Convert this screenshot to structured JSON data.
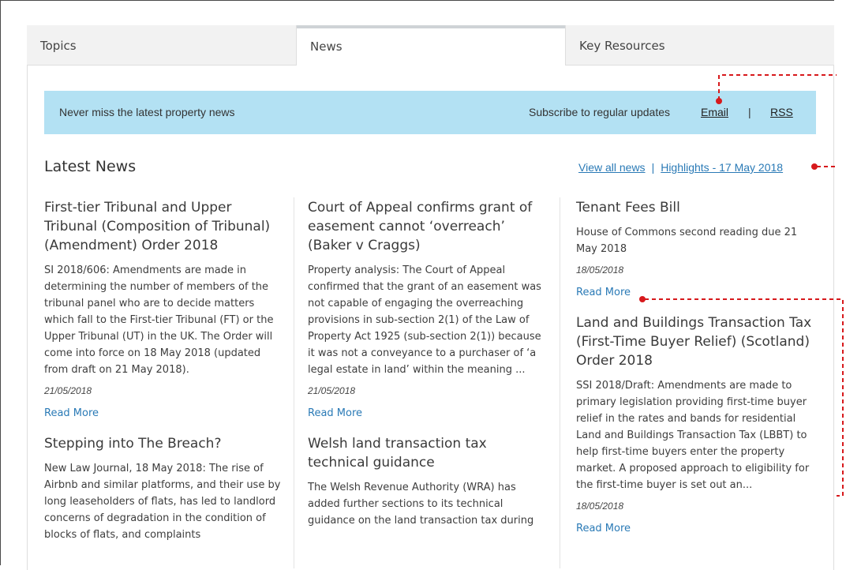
{
  "tabs": [
    {
      "label": "Topics"
    },
    {
      "label": "News"
    },
    {
      "label": "Key Resources"
    }
  ],
  "banner": {
    "message": "Never miss the latest property news",
    "subscribe_text": "Subscribe to regular updates",
    "email_label": "Email",
    "separator": "|",
    "rss_label": "RSS",
    "color": "#b3e1f3"
  },
  "latest": {
    "heading": "Latest News",
    "view_all_label": "View all news",
    "separator": "|",
    "highlights_label": "Highlights - 17 May 2018"
  },
  "columns": [
    [
      {
        "title": "First-tier Tribunal and Upper Tribunal (Composition of Tribunal) (Amendment) Order 2018",
        "body": "SI 2018/606: Amendments are made in determining the number of members of the tribunal panel who are to decide matters which fall to the First-tier Tribunal (FT) or the Upper Tribunal (UT) in the UK. The Order will come into force on 18 May 2018 (updated from draft on 21 May 2018).",
        "date": "21/05/2018",
        "read_more": "Read More"
      },
      {
        "title": "Stepping into The Breach?",
        "body": "New Law Journal, 18 May 2018: The rise of Airbnb and similar platforms, and their use by long leaseholders of flats, has led to landlord concerns of degradation in the condition of blocks of flats, and complaints",
        "date": "",
        "read_more": ""
      }
    ],
    [
      {
        "title": "Court of Appeal confirms grant of easement cannot ‘overreach’ (Baker v Craggs)",
        "body": "Property analysis: The Court of Appeal confirmed that the grant of an easement was not capable of engaging the overreaching provisions in sub-section 2(1) of the Law of Property Act 1925 (sub-section 2(1)) because it was not a conveyance to a purchaser of ‘a legal estate in land’ within the meaning ...",
        "date": "21/05/2018",
        "read_more": "Read More"
      },
      {
        "title": "Welsh land transaction tax technical guidance",
        "body": "The Welsh Revenue Authority (WRA) has added further sections to its technical guidance on the land transaction tax during",
        "date": "",
        "read_more": ""
      }
    ],
    [
      {
        "title": "Tenant Fees Bill",
        "body": "House of Commons second reading due 21 May 2018",
        "date": "18/05/2018",
        "read_more": "Read More"
      },
      {
        "title": "Land and Buildings Transaction Tax (First-Time Buyer Relief) (Scotland) Order 2018",
        "body": "SSI 2018/Draft: Amendments are made to primary legislation providing first-time buyer relief in the rates and bands for residential Land and Buildings Transaction Tax (LBBT) to help first-time buyers enter the property market. A proposed approach to eligibility for the first-time buyer is set out an...",
        "date": "18/05/2018",
        "read_more": "Read More"
      }
    ]
  ],
  "callout_color": "#d7191c"
}
